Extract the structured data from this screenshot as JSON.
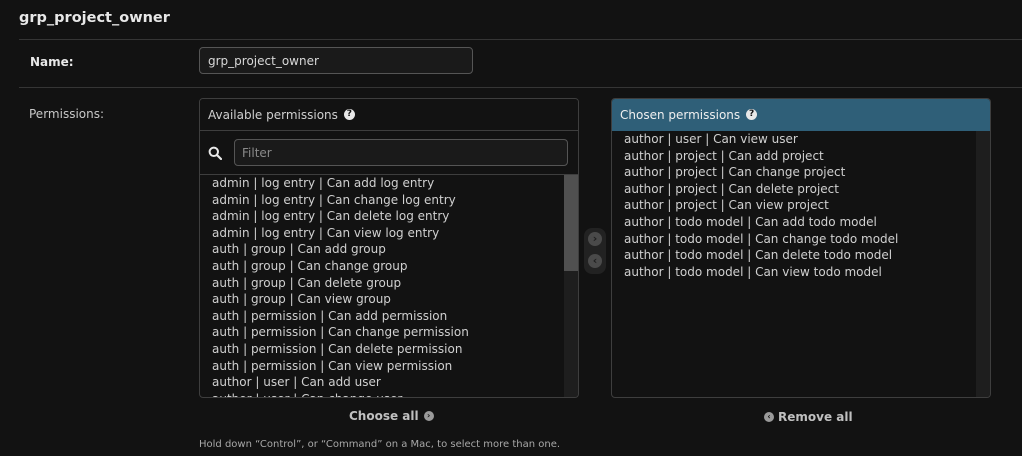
{
  "title": "grp_project_owner",
  "name_field": {
    "label": "Name:",
    "value": "grp_project_owner"
  },
  "permissions": {
    "label": "Permissions:",
    "available": {
      "title": "Available permissions",
      "filter_placeholder": "Filter",
      "items": [
        "admin | log entry | Can add log entry",
        "admin | log entry | Can change log entry",
        "admin | log entry | Can delete log entry",
        "admin | log entry | Can view log entry",
        "auth | group | Can add group",
        "auth | group | Can change group",
        "auth | group | Can delete group",
        "auth | group | Can view group",
        "auth | permission | Can add permission",
        "auth | permission | Can change permission",
        "auth | permission | Can delete permission",
        "auth | permission | Can view permission",
        "author | user | Can add user",
        "author | user | Can change user"
      ]
    },
    "chosen": {
      "title": "Chosen permissions",
      "items": [
        "author | user | Can view user",
        "author | project | Can add project",
        "author | project | Can change project",
        "author | project | Can delete project",
        "author | project | Can view project",
        "author | todo model | Can add todo model",
        "author | todo model | Can change todo model",
        "author | todo model | Can delete todo model",
        "author | todo model | Can view todo model"
      ]
    },
    "choose_all": "Choose all",
    "remove_all": "Remove all",
    "help_text": "Hold down “Control”, or “Command” on a Mac, to select more than one."
  }
}
